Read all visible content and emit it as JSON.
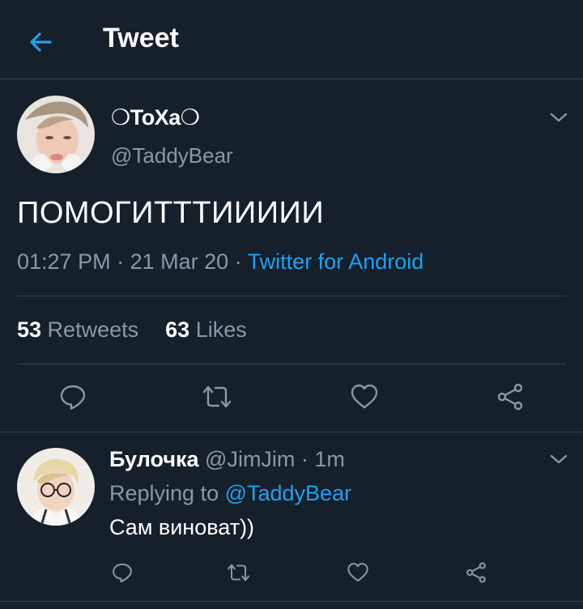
{
  "header": {
    "title": "Tweet",
    "back_icon": "arrow-left-icon",
    "accent": "#1da1f2"
  },
  "tweet": {
    "display_name": "❍ToXa❍",
    "handle": "@TaddyBear",
    "text": "ПОМОГИТТТИИИИИ",
    "time": "01:27 PM",
    "separator": " · ",
    "date": "21 Mar 20",
    "source": "Twitter for Android",
    "retweets_count": "53",
    "retweets_label": " Retweets",
    "likes_count": "63",
    "likes_label": " Likes"
  },
  "actions": [
    "reply-icon",
    "retweet-icon",
    "like-icon",
    "share-icon"
  ],
  "reply": {
    "name": "Булочка",
    "handle": " @JimJim",
    "time": " · 1m",
    "replying_prefix": "Replying to ",
    "replying_to": "@TaddyBear",
    "text": "Сам виноват))"
  },
  "colors": {
    "background": "#15202b",
    "muted": "#8899a6",
    "divider": "#38444d",
    "link": "#1da1f2"
  }
}
